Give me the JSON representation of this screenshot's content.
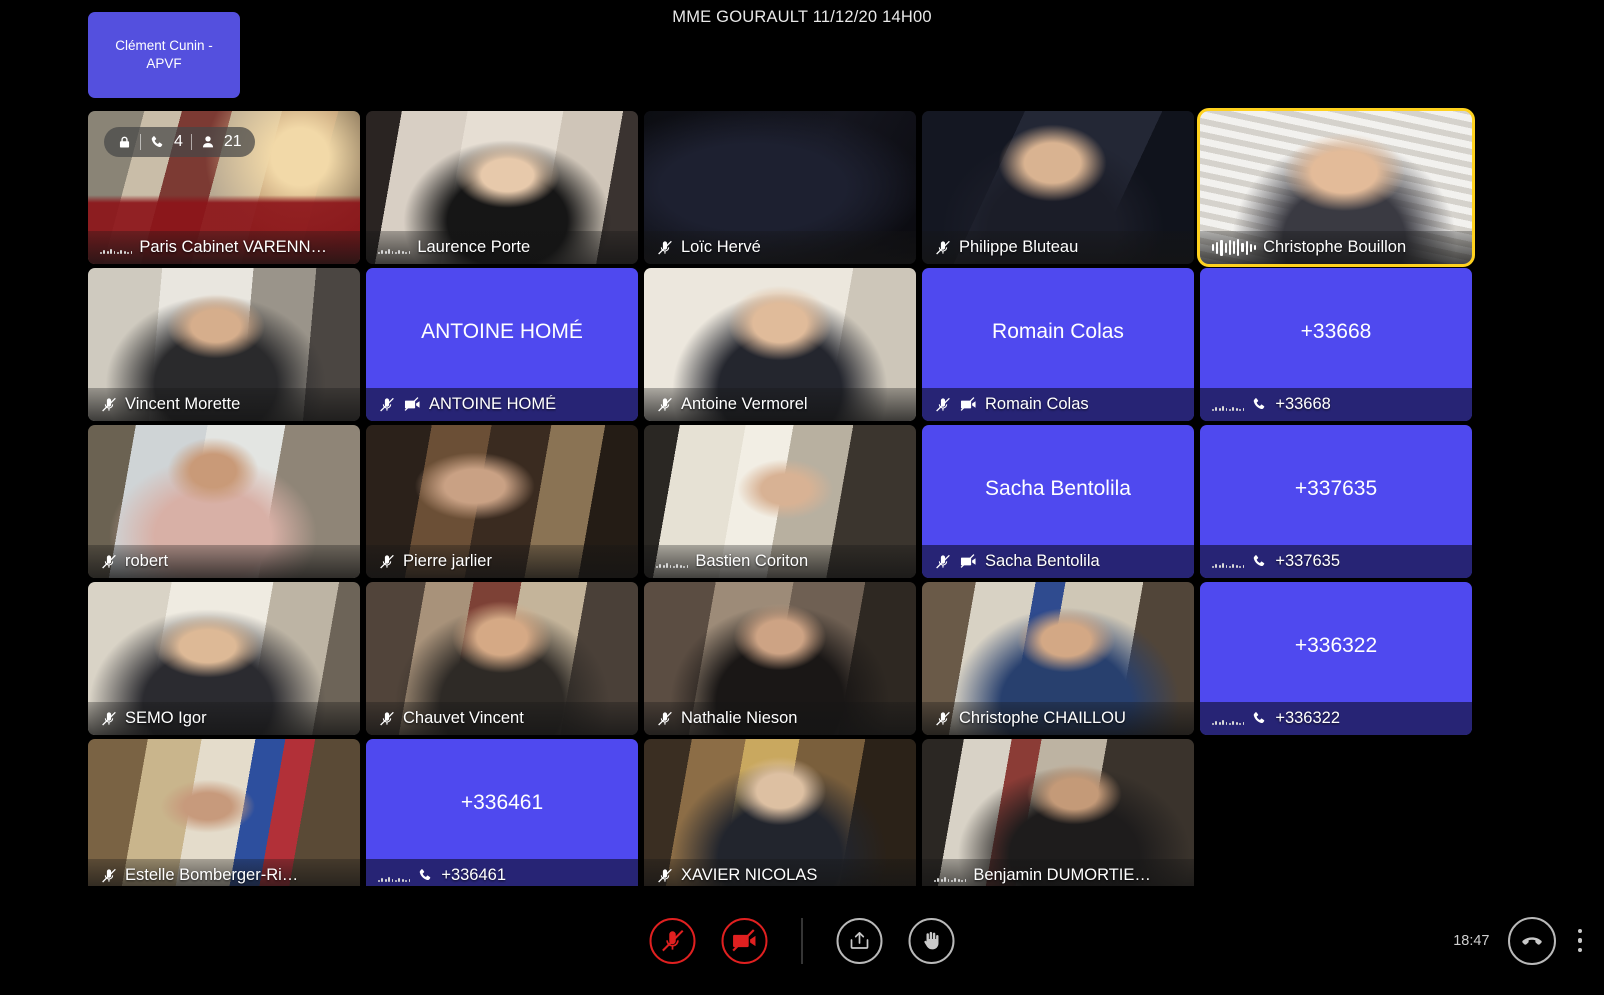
{
  "header": {
    "title": "MME GOURAULT 11/12/20 14H00"
  },
  "selfview": {
    "label": "Clément Cunin - APVF",
    "name": "self-view-tile"
  },
  "room_badge": {
    "lock_icon": "lock-icon",
    "phone_icon": "phone-icon",
    "phone_count": "4",
    "people_icon": "people-icon",
    "people_count": "21"
  },
  "colors": {
    "avatar_purple": "#4f49ef",
    "selfview_purple": "#5450de",
    "speaking_border": "#ffd21e",
    "danger_red": "#e02020",
    "strip_text": "#ffffff",
    "background": "#000000"
  },
  "grid": {
    "columns": 5,
    "rows": 5,
    "tiles": [
      {
        "id": "paris-cabinet-varenne",
        "name": "Paris Cabinet VARENN…",
        "kind": "video",
        "audio": "idle-wave",
        "camera_off": false,
        "speaking": false,
        "has_room_badge": true,
        "scene": "conference-room-red-table"
      },
      {
        "id": "laurence-porte",
        "name": "Laurence Porte",
        "kind": "video",
        "audio": "idle-wave",
        "camera_off": false,
        "speaking": false,
        "has_room_badge": false,
        "scene": "woman-blonde-posters"
      },
      {
        "id": "loic-herve",
        "name": "Loïc Hervé",
        "kind": "video",
        "audio": "muted",
        "camera_off": false,
        "speaking": false,
        "has_room_badge": false,
        "scene": "dark-room"
      },
      {
        "id": "philippe-bluteau",
        "name": "Philippe Bluteau",
        "kind": "video",
        "audio": "muted",
        "camera_off": false,
        "speaking": false,
        "has_room_badge": false,
        "scene": "man-glasses-dark"
      },
      {
        "id": "christophe-bouillon",
        "name": "Christophe Bouillon",
        "kind": "video",
        "audio": "active-wave",
        "camera_off": false,
        "speaking": true,
        "has_room_badge": false,
        "scene": "man-glasses-bright-blinds"
      },
      {
        "id": "vincent-morette",
        "name": "Vincent Morette",
        "kind": "video",
        "audio": "muted",
        "camera_off": false,
        "speaking": false,
        "has_room_badge": false,
        "scene": "man-office-window"
      },
      {
        "id": "antoine-home",
        "name": "ANTOINE HOMÉ",
        "kind": "avatar",
        "avatar_text": "ANTOINE HOMÉ",
        "audio": "muted",
        "camera_off": true,
        "speaking": false,
        "has_room_badge": false
      },
      {
        "id": "antoine-vermorel",
        "name": "Antoine Vermorel",
        "kind": "video",
        "audio": "muted",
        "camera_off": false,
        "speaking": false,
        "has_room_badge": false,
        "scene": "man-glasses-white-wall"
      },
      {
        "id": "romain-colas",
        "name": "Romain Colas",
        "kind": "avatar",
        "avatar_text": "Romain Colas",
        "audio": "muted",
        "camera_off": true,
        "speaking": false,
        "has_room_badge": false
      },
      {
        "id": "phone-33668",
        "name": "+33668",
        "kind": "phone",
        "avatar_text": "+33668",
        "audio": "idle-wave",
        "camera_off": false,
        "speaking": false,
        "has_room_badge": false
      },
      {
        "id": "robert",
        "name": "robert",
        "kind": "video",
        "audio": "muted",
        "camera_off": false,
        "speaking": false,
        "has_room_badge": false,
        "scene": "man-pink-shirt-window"
      },
      {
        "id": "pierre-jarlier",
        "name": "Pierre jarlier",
        "kind": "video",
        "audio": "muted",
        "camera_off": false,
        "speaking": false,
        "has_room_badge": false,
        "scene": "man-bookshelf-dark"
      },
      {
        "id": "bastien-coriton",
        "name": "Bastien Coriton",
        "kind": "video",
        "audio": "idle-wave",
        "camera_off": false,
        "speaking": false,
        "has_room_badge": false,
        "scene": "man-curtains-window"
      },
      {
        "id": "sacha-bentolila",
        "name": "Sacha Bentolila",
        "kind": "avatar",
        "avatar_text": "Sacha Bentolila",
        "audio": "muted",
        "camera_off": true,
        "speaking": false,
        "has_room_badge": false
      },
      {
        "id": "phone-337635",
        "name": "+337635",
        "kind": "phone",
        "avatar_text": "+337635",
        "audio": "idle-wave",
        "camera_off": false,
        "speaking": false,
        "has_room_badge": false
      },
      {
        "id": "semo-igor",
        "name": "SEMO Igor",
        "kind": "video",
        "audio": "muted",
        "camera_off": false,
        "speaking": false,
        "has_room_badge": false,
        "scene": "man-bright-room-frames"
      },
      {
        "id": "chauvet-vincent",
        "name": "Chauvet Vincent",
        "kind": "video",
        "audio": "muted",
        "camera_off": false,
        "speaking": false,
        "has_room_badge": false,
        "scene": "man-beard-bookshelf"
      },
      {
        "id": "nathalie-nieson",
        "name": "Nathalie Nieson",
        "kind": "video",
        "audio": "muted",
        "camera_off": false,
        "speaking": false,
        "has_room_badge": false,
        "scene": "woman-dark-room"
      },
      {
        "id": "christophe-chaillou",
        "name": "Christophe CHAILLOU",
        "kind": "video",
        "audio": "muted",
        "camera_off": false,
        "speaking": false,
        "has_room_badge": false,
        "scene": "man-office-flag"
      },
      {
        "id": "phone-336322",
        "name": "+336322",
        "kind": "phone",
        "avatar_text": "+336322",
        "audio": "idle-wave",
        "camera_off": false,
        "speaking": false,
        "has_room_badge": false
      },
      {
        "id": "estelle-bomberger",
        "name": "Estelle Bomberger-Ri…",
        "kind": "video",
        "audio": "muted",
        "camera_off": false,
        "speaking": false,
        "has_room_badge": false,
        "scene": "woman-office-flag"
      },
      {
        "id": "phone-336461",
        "name": "+336461",
        "kind": "phone",
        "avatar_text": "+336461",
        "audio": "idle-wave",
        "camera_off": false,
        "speaking": false,
        "has_room_badge": false
      },
      {
        "id": "xavier-nicolas",
        "name": "XAVIER NICOLAS",
        "kind": "video",
        "audio": "muted",
        "camera_off": false,
        "speaking": false,
        "has_room_badge": false,
        "scene": "elderly-man-bookshelf"
      },
      {
        "id": "benjamin-dumortier",
        "name": "Benjamin DUMORTIE…",
        "kind": "video",
        "audio": "idle-wave",
        "camera_off": false,
        "speaking": false,
        "has_room_badge": false,
        "scene": "man-dark-shelves"
      },
      {
        "id": "empty-slot",
        "name": "",
        "kind": "empty",
        "audio": "none",
        "camera_off": false,
        "speaking": false,
        "has_room_badge": false
      }
    ]
  },
  "toolbar": {
    "mic_button": {
      "label": "Microphone",
      "icon": "mic-off-icon",
      "state": "muted"
    },
    "camera_button": {
      "label": "Camera",
      "icon": "camera-off-icon",
      "state": "off"
    },
    "share_button": {
      "label": "Share screen",
      "icon": "share-screen-icon"
    },
    "hand_button": {
      "label": "Raise hand",
      "icon": "raise-hand-icon"
    },
    "clock": "18:47",
    "hangup_button": {
      "label": "Leave call",
      "icon": "hangup-icon"
    },
    "more_button": {
      "label": "More options",
      "icon": "kebab-menu-icon"
    }
  }
}
